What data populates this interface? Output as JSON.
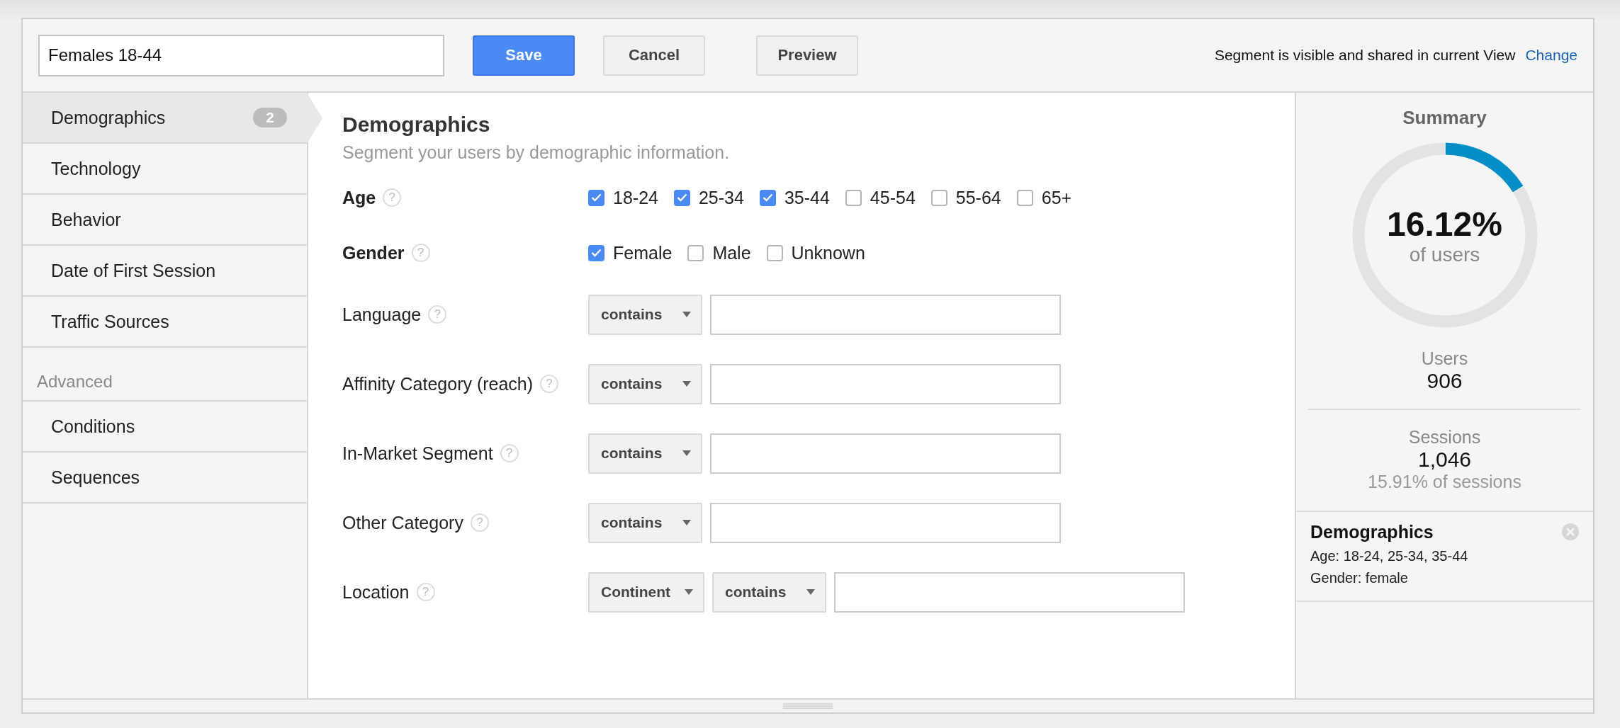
{
  "header": {
    "segment_name": "Females 18-44",
    "buttons": [
      {
        "label": "Save",
        "kind": "primary"
      },
      {
        "label": "Cancel",
        "kind": "default"
      },
      {
        "label": "Preview",
        "kind": "default"
      }
    ],
    "visibility_text": "Segment is visible and shared in current View",
    "visibility_link": "Change"
  },
  "sidebar": {
    "items": [
      {
        "label": "Demographics",
        "selected": true,
        "badge": "2"
      },
      {
        "label": "Technology",
        "selected": false
      },
      {
        "label": "Behavior",
        "selected": false
      },
      {
        "label": "Date of First Session",
        "selected": false
      },
      {
        "label": "Traffic Sources",
        "selected": false
      }
    ],
    "section_label": "Advanced",
    "advanced_items": [
      {
        "label": "Conditions",
        "selected": false
      },
      {
        "label": "Sequences",
        "selected": false
      }
    ]
  },
  "main": {
    "title": "Demographics",
    "subtitle": "Segment your users by demographic information.",
    "rows": [
      {
        "label": "Age",
        "help": "?",
        "kind": "checkboxes",
        "options": [
          {
            "label": "18-24",
            "checked": true
          },
          {
            "label": "25-34",
            "checked": true
          },
          {
            "label": "35-44",
            "checked": true
          },
          {
            "label": "45-54",
            "checked": false
          },
          {
            "label": "55-64",
            "checked": false
          },
          {
            "label": "65+",
            "checked": false
          }
        ]
      },
      {
        "label": "Gender",
        "help": "?",
        "kind": "checkboxes",
        "options": [
          {
            "label": "Female",
            "checked": true
          },
          {
            "label": "Male",
            "checked": false
          },
          {
            "label": "Unknown",
            "checked": false
          }
        ]
      },
      {
        "label": "Language",
        "help": "?",
        "kind": "filter",
        "dropdowns": [
          "contains"
        ]
      },
      {
        "label": "Affinity Category (reach)",
        "help": "?",
        "kind": "filter",
        "dropdowns": [
          "contains"
        ]
      },
      {
        "label": "In-Market Segment",
        "help": "?",
        "kind": "filter",
        "dropdowns": [
          "contains"
        ]
      },
      {
        "label": "Other Category",
        "help": "?",
        "kind": "filter",
        "dropdowns": [
          "contains"
        ]
      },
      {
        "label": "Location",
        "help": "?",
        "kind": "filter",
        "dropdowns": [
          "Continent",
          "contains"
        ]
      }
    ]
  },
  "summary": {
    "title": "Summary",
    "percent": "16.12%",
    "percent_caption": "of users",
    "chart_data": {
      "type": "donut",
      "values": [
        16.12,
        83.88
      ]
    },
    "users_label": "Users",
    "users_value": "906",
    "sessions_label": "Sessions",
    "sessions_value": "1,046",
    "sessions_share": "15.91% of sessions",
    "card": {
      "title": "Demographics",
      "lines": [
        "Age: 18-24, 25-34, 35-44",
        "Gender: female"
      ]
    }
  }
}
